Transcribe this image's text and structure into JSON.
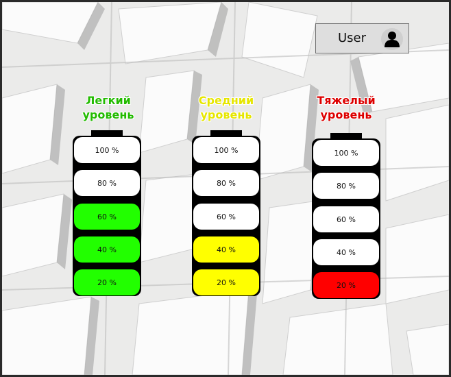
{
  "user_button": {
    "label": "User",
    "icon": "user-icon"
  },
  "levels": [
    {
      "title_line1": "Легкий",
      "title_line2": "уровень",
      "title_color": "#22bb00",
      "cells": [
        "100 %",
        "80 %",
        "60 %",
        "40 %",
        "20 %"
      ],
      "cell_colors": [
        "#ffffff",
        "#ffffff",
        "#22ff00",
        "#22ff00",
        "#22ff00"
      ]
    },
    {
      "title_line1": "Средний",
      "title_line2": "уровень",
      "title_color": "#e6e600",
      "cells": [
        "100 %",
        "80 %",
        "60 %",
        "40 %",
        "20 %"
      ],
      "cell_colors": [
        "#ffffff",
        "#ffffff",
        "#ffffff",
        "#ffff00",
        "#ffff00"
      ]
    },
    {
      "title_line1": "Тяжелый",
      "title_line2": "уровень",
      "title_color": "#dd0000",
      "cells": [
        "100 %",
        "80 %",
        "60 %",
        "40 %",
        "20 %"
      ],
      "cell_colors": [
        "#ffffff",
        "#ffffff",
        "#ffffff",
        "#ffffff",
        "#ff0000"
      ]
    }
  ]
}
